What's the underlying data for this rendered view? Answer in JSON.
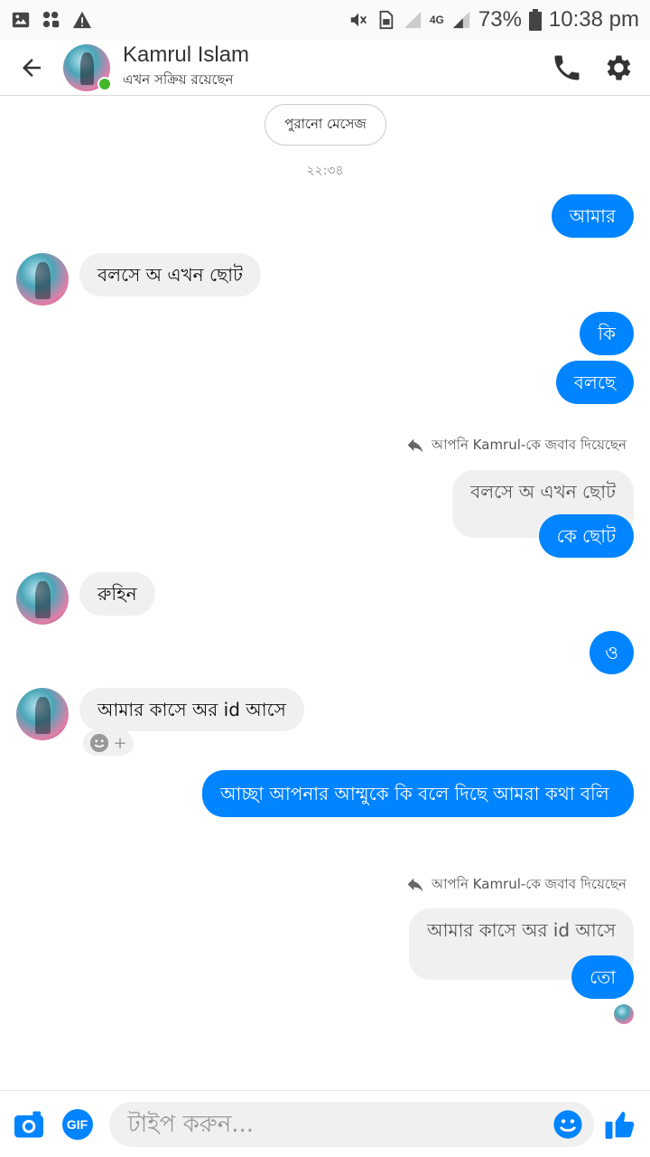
{
  "statusbar": {
    "battery": "73%",
    "time": "10:38 pm",
    "network": "4G"
  },
  "header": {
    "name": "Kamrul Islam",
    "status": "এখন সক্রিয় রয়েছেন"
  },
  "chat": {
    "older_messages_button": "পুরানো মেসেজ",
    "timestamp": "২২:৩৪",
    "reply_note": "আপনি Kamrul-কে জবাব দিয়েছেন",
    "messages": [
      {
        "dir": "out",
        "text": "আমার"
      },
      {
        "dir": "in",
        "text": "বলসে অ এখন ছোট"
      },
      {
        "dir": "out",
        "text": "কি"
      },
      {
        "dir": "out",
        "text": "বলছে"
      },
      {
        "dir": "quoted",
        "text": "বলসে অ এখন ছোট"
      },
      {
        "dir": "out",
        "text": "কে ছোট"
      },
      {
        "dir": "in",
        "text": "রুহিন"
      },
      {
        "dir": "out",
        "text": "ও"
      },
      {
        "dir": "in",
        "text": "আমার কাসে অর  id আসে"
      },
      {
        "dir": "out",
        "text": "আচ্ছা আপনার আম্মুকে কি বলে দিছে আমরা কথা বলি"
      },
      {
        "dir": "quoted",
        "text": "আমার কাসে অর  id আসে"
      },
      {
        "dir": "out",
        "text": "তো"
      }
    ]
  },
  "composer": {
    "placeholder": "টাইপ করুন...",
    "gif_label": "GIF"
  },
  "colors": {
    "accent": "#0084ff",
    "incoming_bubble": "#f1f0f0",
    "online": "#42b72a"
  },
  "icons": [
    "gallery-icon",
    "shield-icon",
    "warning-icon",
    "mute-icon",
    "sim-icon",
    "signal-icon",
    "battery-icon",
    "back-arrow-icon",
    "phone-icon",
    "gear-icon",
    "reply-icon",
    "emoji-react-icon",
    "camera-icon",
    "gif-icon",
    "emoji-icon",
    "like-icon"
  ]
}
